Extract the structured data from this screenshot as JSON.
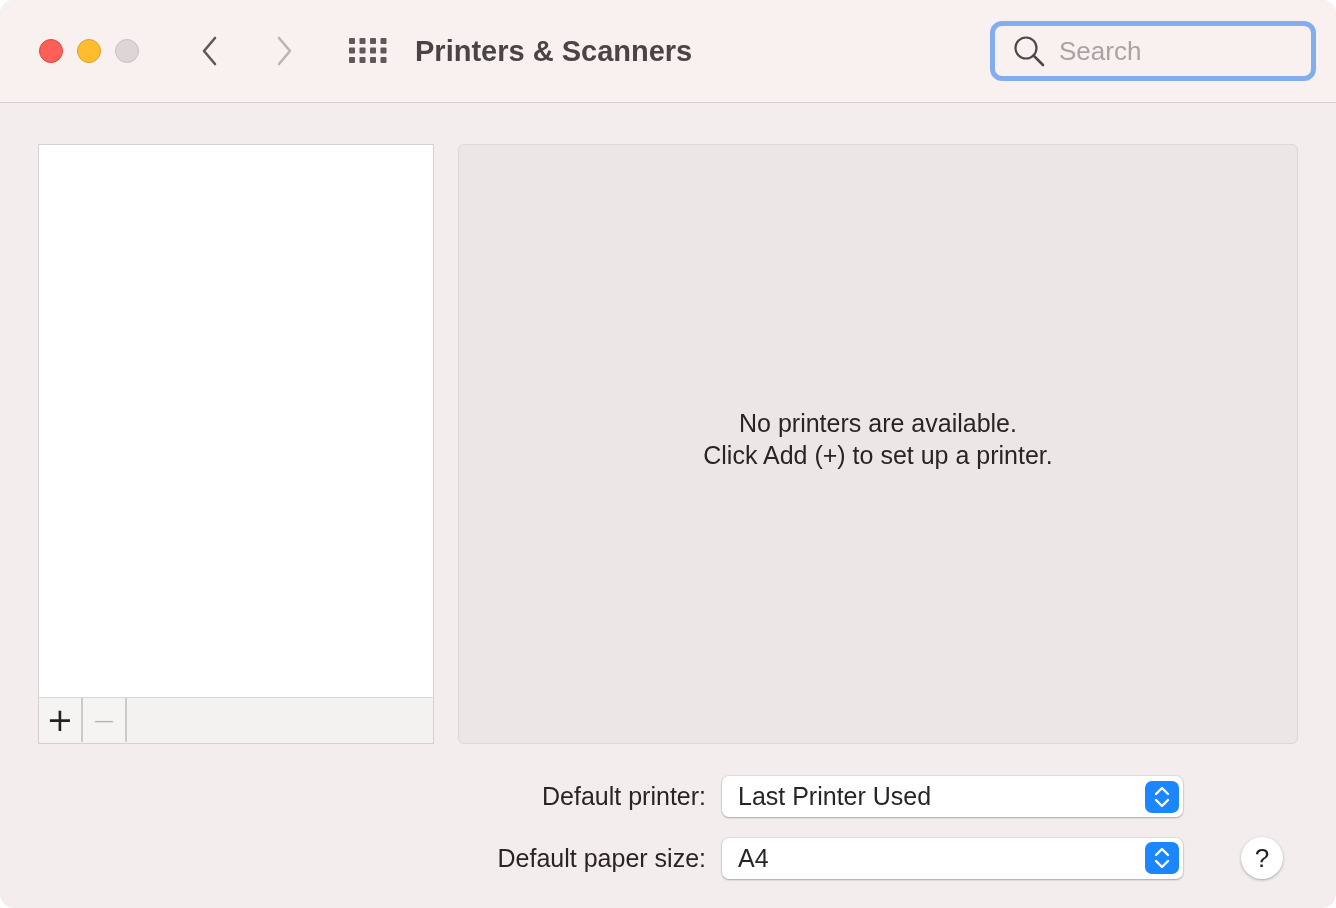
{
  "window": {
    "title": "Printers & Scanners"
  },
  "window_controls": [
    {
      "kind": "close",
      "disabled": false
    },
    {
      "kind": "minimize",
      "disabled": false
    },
    {
      "kind": "zoom",
      "disabled": true
    }
  ],
  "navigation": [
    {
      "kind": "back",
      "disabled": false
    },
    {
      "kind": "forward",
      "disabled": true
    }
  ],
  "search": {
    "placeholder": "Search",
    "focused": true
  },
  "printer_list": {
    "buttons": [
      {
        "label": "+",
        "disabled": false
      },
      {
        "label": "—",
        "disabled": true
      }
    ]
  },
  "message": [
    "No printers are available.",
    "Click Add (+) to set up a printer."
  ],
  "settings": [
    {
      "label": "Default printer:",
      "value": "Last Printer Used"
    },
    {
      "label": "Default paper size:",
      "value": "A4"
    }
  ],
  "help": "?"
}
